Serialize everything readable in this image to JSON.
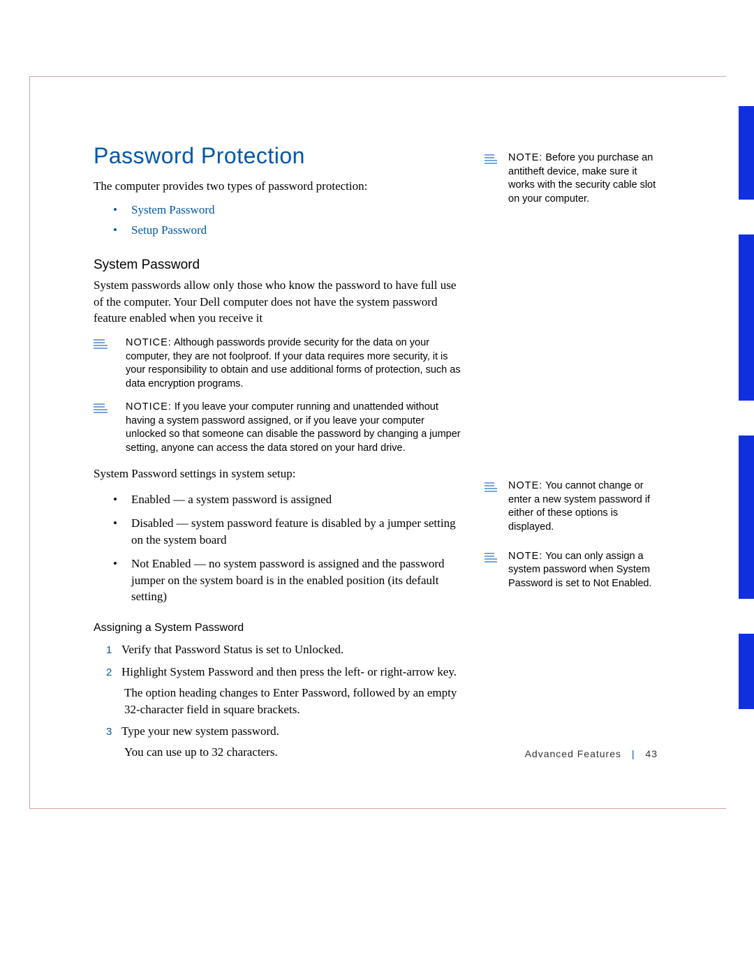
{
  "title": "Password Protection",
  "intro": "The computer provides two types of password protection:",
  "links": {
    "system": "System Password",
    "setup": "Setup Password"
  },
  "section1": {
    "heading": "System Password",
    "para": "System passwords allow only those who know the password to have full use of the computer. Your Dell computer does not have the system password feature enabled when you receive it"
  },
  "notices": {
    "n1_lead": "NOTICE:",
    "n1_body": " Although passwords provide security for the data on your computer, they are not foolproof. If your data requires more security, it is your responsibility to obtain and use additional forms of protection, such as data encryption programs.",
    "n2_lead": "NOTICE:",
    "n2_body": " If you leave your computer running and unattended without having a system password assigned, or if you leave your computer unlocked so that someone can disable the password by changing a jumper setting, anyone can access the data stored on your hard drive."
  },
  "settings_intro": "System Password settings in system setup:",
  "settings": {
    "b1": "Enabled — a system password is assigned",
    "b2": "Disabled — system password feature is disabled by a jumper setting on the system board",
    "b3": "Not Enabled — no system password is assigned and the password jumper on the system board is in the enabled position (its default setting)"
  },
  "assign": {
    "heading": "Assigning a System Password",
    "s1": "Verify that Password Status is set to Unlocked.",
    "s2": "Highlight System Password and then press the left- or right-arrow key.",
    "s2b": "The option heading changes to Enter Password, followed by an empty 32-character field in square brackets.",
    "s3": "Type your new system password.",
    "s3b": "You can use up to 32 characters.",
    "num1": "1",
    "num2": "2",
    "num3": "3"
  },
  "side": {
    "note1_lead": "NOTE:",
    "note1_body": " Before you purchase an antitheft device, make sure it works with the security cable slot on your computer.",
    "note2_lead": "NOTE:",
    "note2_body": " You cannot change or enter a new system password if either of these options is displayed.",
    "note3_lead": "NOTE:",
    "note3_body": " You can only assign a system password when System Password is set to Not Enabled."
  },
  "footer": {
    "section": "Advanced Features",
    "page": "43"
  },
  "tabs": {
    "h1": 134,
    "g1": 50,
    "h2": 238,
    "g2": 50,
    "h3": 234,
    "g3": 50,
    "h4": 108
  }
}
